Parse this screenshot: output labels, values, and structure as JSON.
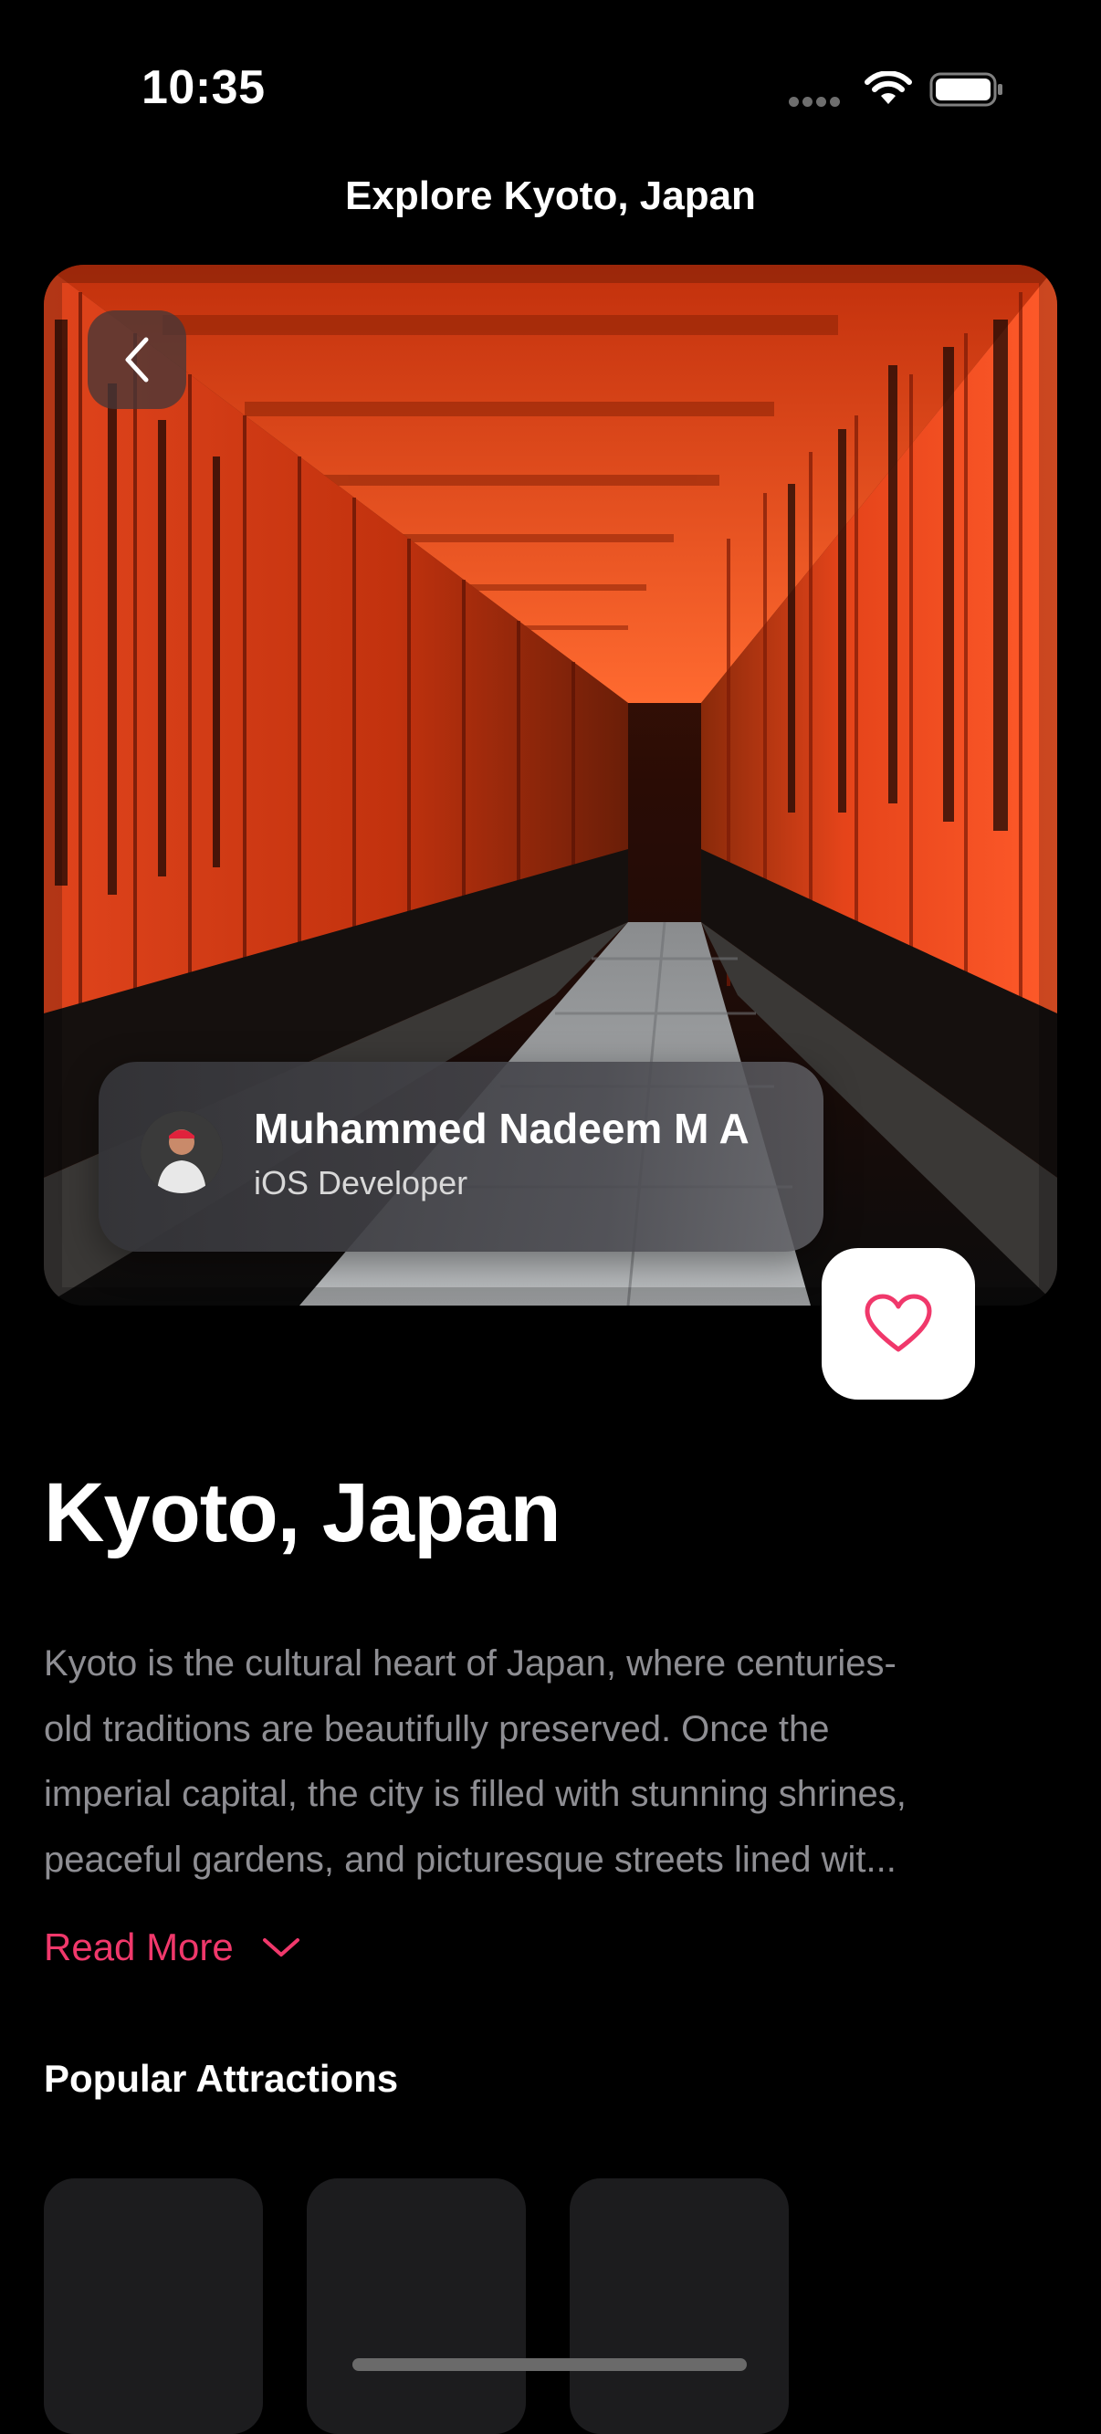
{
  "status_bar": {
    "time": "10:35",
    "wifi_icon": "wifi-icon",
    "battery_icon": "battery-icon"
  },
  "nav": {
    "title": "Explore Kyoto, Japan",
    "back_icon": "chevron-left-icon"
  },
  "hero": {
    "image": "torii-gates-photo",
    "author": {
      "name": "Muhammed Nadeem M A",
      "role": "iOS Developer"
    },
    "favorite_icon": "heart-icon"
  },
  "place": {
    "title": "Kyoto, Japan",
    "description_lines": [
      "Kyoto is the cultural heart of Japan, where centuries-",
      "old traditions are beautifully preserved. Once the",
      "imperial capital, the city is filled with stunning shrines,",
      "peaceful gardens, and picturesque streets lined wit..."
    ],
    "read_more": "Read More"
  },
  "attractions": {
    "title": "Popular Attractions",
    "cards": [
      "",
      "",
      ""
    ]
  },
  "colors": {
    "accent": "#f0386b",
    "background": "#000000",
    "card": "#1c1c1e",
    "secondary_text": "#8e8e93"
  }
}
